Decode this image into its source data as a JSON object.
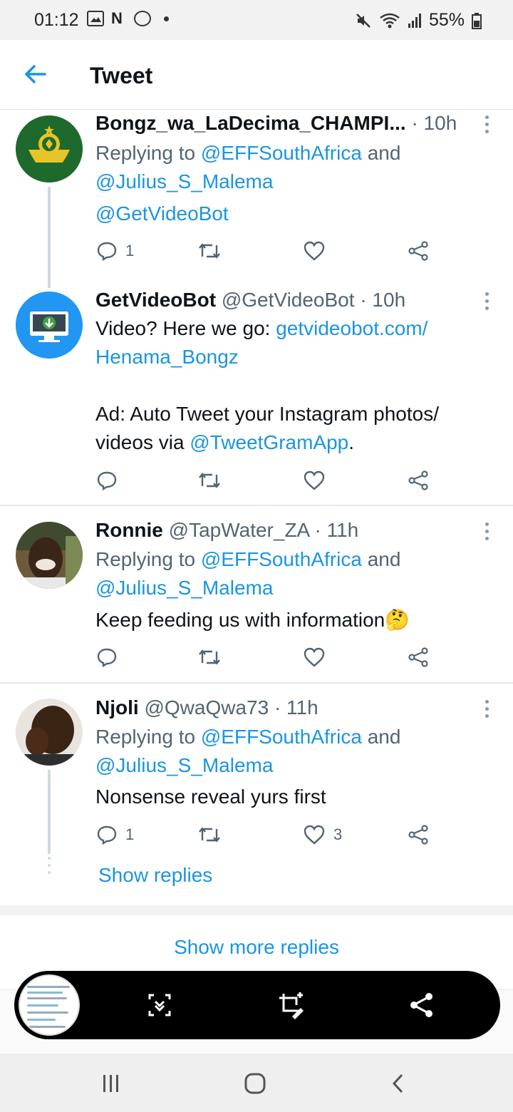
{
  "status_bar": {
    "time": "01:12",
    "battery": "55%",
    "icons": [
      "image-icon",
      "n-icon",
      "whatsapp-icon",
      "dot-icon",
      "mute-icon",
      "wifi-icon",
      "signal-icon",
      "battery-icon"
    ]
  },
  "header": {
    "title": "Tweet"
  },
  "tweets": [
    {
      "name": "Bongz_wa_LaDecima_CHAMPI...",
      "handle": "",
      "time": "· 10h",
      "reply_prefix": "Replying to ",
      "reply_to_1": "@EFFSouthAfrica",
      "reply_and": " and",
      "reply_to_2": "@Julius_S_Malema",
      "body_1": "@GetVideoBot",
      "replies": "1",
      "retweets": "",
      "likes": ""
    },
    {
      "name": "GetVideoBot",
      "handle": "@GetVideoBot",
      "time": "· 10h",
      "body_1_text": "Video? Here we go: ",
      "body_1_link": "getvideobot.com/",
      "body_2_link": "Henama_Bongz",
      "body_3": "Ad: Auto Tweet your Instagram photos/",
      "body_4_text": "videos via ",
      "body_4_link": "@TweetGramApp",
      "body_4_end": ".",
      "replies": "",
      "retweets": "",
      "likes": ""
    },
    {
      "name": "Ronnie",
      "handle": "@TapWater_ZA",
      "time": "· 11h",
      "reply_prefix": "Replying to ",
      "reply_to_1": "@EFFSouthAfrica",
      "reply_and": " and",
      "reply_to_2": "@Julius_S_Malema",
      "body_1": "Keep feeding us with information",
      "emoji": "🤔",
      "replies": "",
      "retweets": "",
      "likes": ""
    },
    {
      "name": "Njoli",
      "handle": "@QwaQwa73",
      "time": "· 11h",
      "reply_prefix": "Replying to ",
      "reply_to_1": "@EFFSouthAfrica",
      "reply_and": " and",
      "reply_to_2": "@Julius_S_Malema",
      "body_1": "Nonsense reveal yurs first",
      "replies": "1",
      "retweets": "",
      "likes": "3"
    }
  ],
  "show_replies": "Show replies",
  "show_more_replies": "Show more replies",
  "screenshot_toolbar": {
    "buttons": [
      "scroll-capture-icon",
      "crop-edit-icon",
      "share-icon"
    ]
  },
  "nav": {
    "buttons": [
      "recents-icon",
      "home-icon",
      "back-icon"
    ]
  },
  "colors": {
    "link": "#1b95e0",
    "muted": "#536471",
    "text": "#0f1419",
    "thread_line": "#cfd9de"
  }
}
